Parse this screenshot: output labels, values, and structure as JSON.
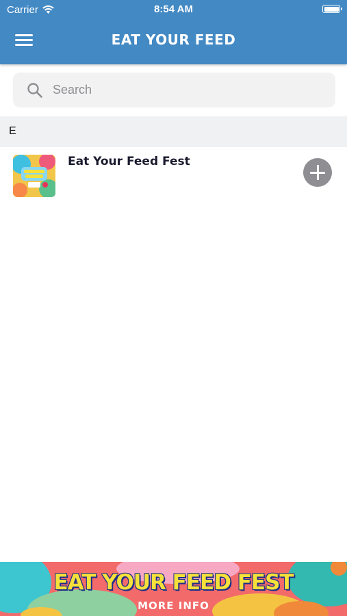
{
  "status_bar": {
    "carrier": "Carrier",
    "time": "8:54 AM"
  },
  "nav": {
    "title": "EAT YOUR FEED",
    "menu_icon": "hamburger-menu-icon"
  },
  "search": {
    "placeholder": "Search",
    "value": ""
  },
  "list": {
    "sections": [
      {
        "letter": "E",
        "items": [
          {
            "title": "Eat Your Feed Fest",
            "thumbnail": "event-thumbnail",
            "action_icon": "add-icon"
          }
        ]
      }
    ]
  },
  "banner": {
    "title": "EAT YOUR FEED FEST",
    "subtitle": "MORE INFO"
  },
  "colors": {
    "header": "#4389c4",
    "section_bg": "#f0f1f3",
    "search_bg": "#f2f2f2",
    "add_button": "#8e8e93"
  }
}
